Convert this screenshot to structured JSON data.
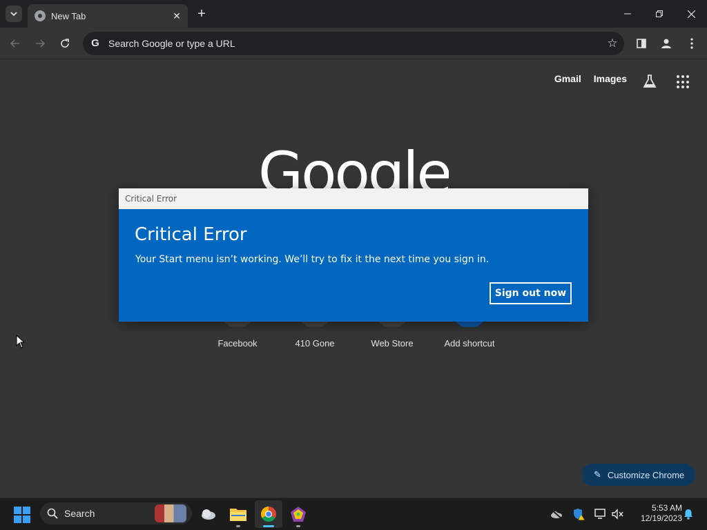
{
  "browser": {
    "tab_title": "New Tab",
    "omnibox_placeholder": "Search Google or type a URL"
  },
  "ntp": {
    "links": [
      "Gmail",
      "Images"
    ],
    "logo_text": "Google",
    "shortcuts": [
      "Facebook",
      "410 Gone",
      "Web Store",
      "Add shortcut"
    ],
    "customize_label": "Customize Chrome"
  },
  "dialog": {
    "window_title": "Critical Error",
    "heading": "Critical Error",
    "message": "Your Start menu isn’t working. We’ll try to fix it the next time you sign in.",
    "button_label": "Sign out now"
  },
  "taskbar": {
    "search_label": "Search",
    "time": "5:53 AM",
    "date": "12/19/2023"
  },
  "colors": {
    "dialog_blue": "#0067c0",
    "chrome_dark": "#353535",
    "taskbar": "#1c1c1c"
  }
}
